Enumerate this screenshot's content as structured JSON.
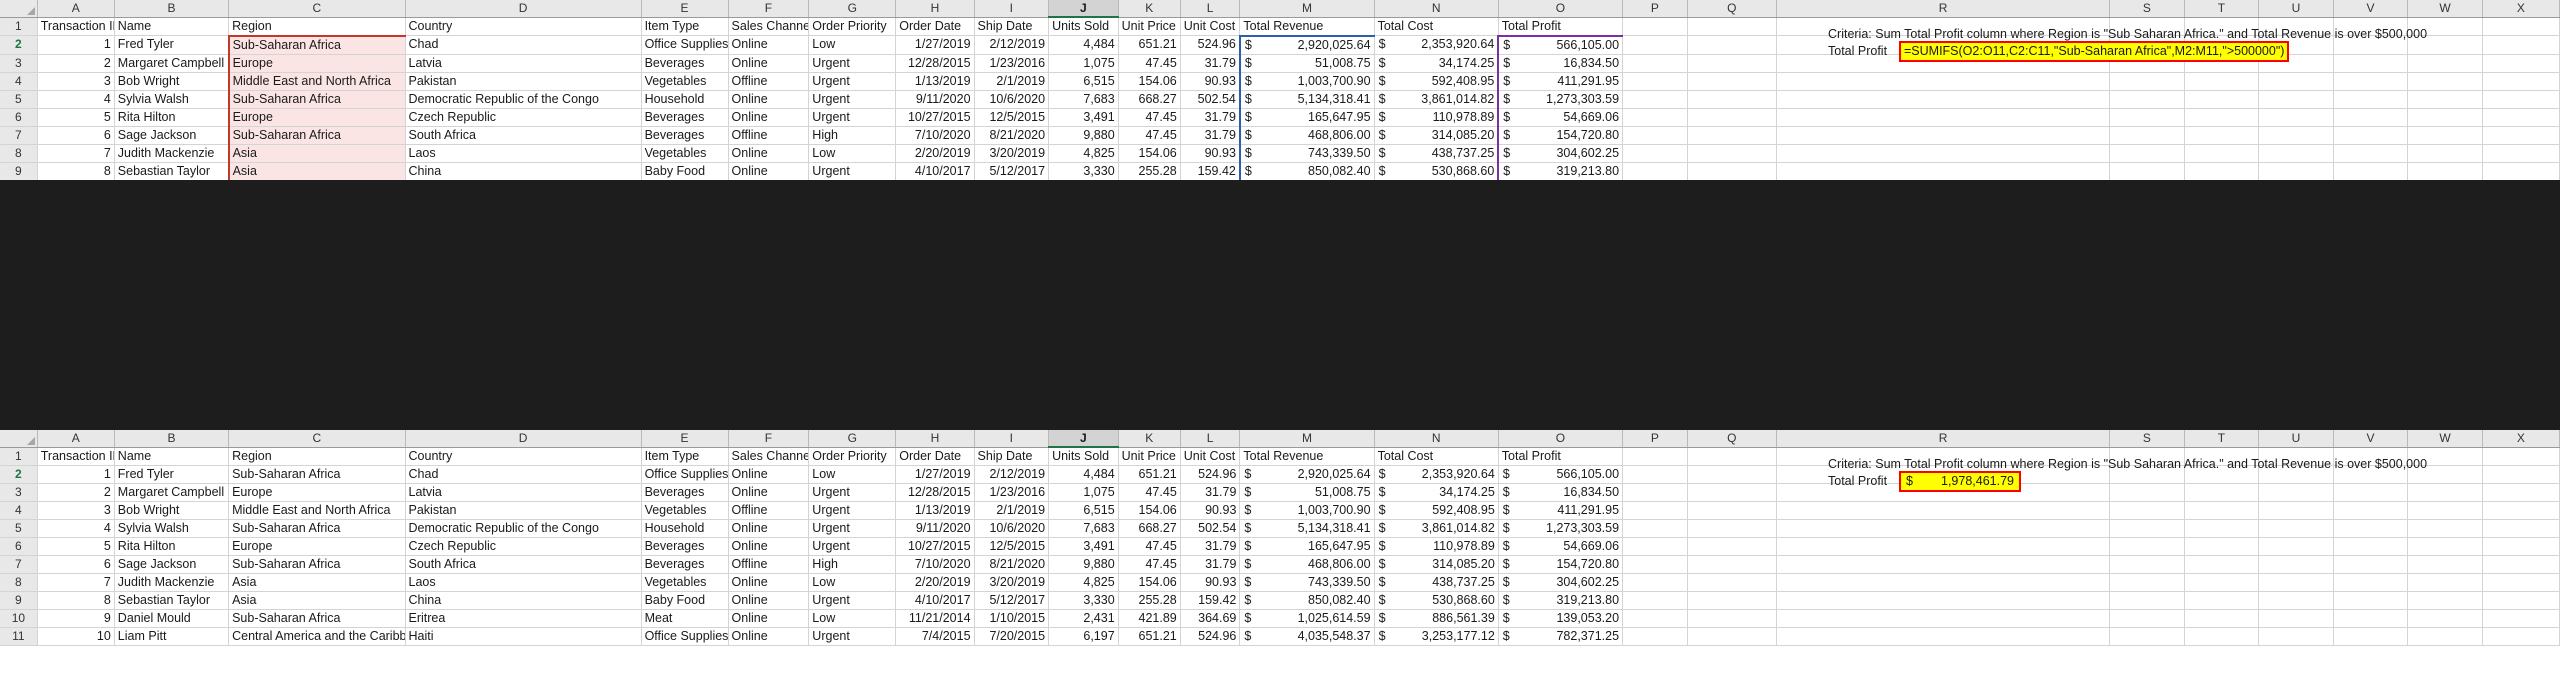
{
  "app": "excel-spreadsheet",
  "columns": [
    "A",
    "B",
    "C",
    "D",
    "E",
    "F",
    "G",
    "H",
    "I",
    "J",
    "K",
    "L",
    "M",
    "N",
    "O",
    "P",
    "Q",
    "R",
    "S",
    "T",
    "U",
    "V",
    "W",
    "X"
  ],
  "row_numbers": [
    "1",
    "2",
    "3",
    "4",
    "5",
    "6",
    "7",
    "8",
    "9",
    "10",
    "11"
  ],
  "selected_column": "J",
  "headers": {
    "a": "Transaction ID",
    "b": "Name",
    "c": "Region",
    "d": "Country",
    "e": "Item Type",
    "f": "Sales Channel",
    "g": "Order Priority",
    "h": "Order Date",
    "i": "Ship Date",
    "j": "Units Sold",
    "k": "Unit Price",
    "l": "Unit Cost",
    "m": "Total Revenue",
    "n": "Total Cost",
    "o": "Total Profit"
  },
  "rows": [
    {
      "id": "1",
      "name": "Fred Tyler",
      "region": "Sub-Saharan Africa",
      "country": "Chad",
      "item": "Office Supplies",
      "channel": "Online",
      "priority": "Low",
      "order_date": "1/27/2019",
      "ship_date": "2/12/2019",
      "units": "4,484",
      "unit_price": "651.21",
      "unit_cost": "524.96",
      "revenue": "2,920,025.64",
      "cost": "2,353,920.64",
      "profit": "566,105.00"
    },
    {
      "id": "2",
      "name": "Margaret Campbell",
      "region": "Europe",
      "country": "Latvia",
      "item": "Beverages",
      "channel": "Online",
      "priority": "Urgent",
      "order_date": "12/28/2015",
      "ship_date": "1/23/2016",
      "units": "1,075",
      "unit_price": "47.45",
      "unit_cost": "31.79",
      "revenue": "51,008.75",
      "cost": "34,174.25",
      "profit": "16,834.50"
    },
    {
      "id": "3",
      "name": "Bob Wright",
      "region": "Middle East and North Africa",
      "country": "Pakistan",
      "item": "Vegetables",
      "channel": "Offline",
      "priority": "Urgent",
      "order_date": "1/13/2019",
      "ship_date": "2/1/2019",
      "units": "6,515",
      "unit_price": "154.06",
      "unit_cost": "90.93",
      "revenue": "1,003,700.90",
      "cost": "592,408.95",
      "profit": "411,291.95"
    },
    {
      "id": "4",
      "name": "Sylvia Walsh",
      "region": "Sub-Saharan Africa",
      "country": "Democratic Republic of the Congo",
      "item": "Household",
      "channel": "Online",
      "priority": "Urgent",
      "order_date": "9/11/2020",
      "ship_date": "10/6/2020",
      "units": "7,683",
      "unit_price": "668.27",
      "unit_cost": "502.54",
      "revenue": "5,134,318.41",
      "cost": "3,861,014.82",
      "profit": "1,273,303.59"
    },
    {
      "id": "5",
      "name": "Rita Hilton",
      "region": "Europe",
      "country": "Czech Republic",
      "item": "Beverages",
      "channel": "Online",
      "priority": "Urgent",
      "order_date": "10/27/2015",
      "ship_date": "12/5/2015",
      "units": "3,491",
      "unit_price": "47.45",
      "unit_cost": "31.79",
      "revenue": "165,647.95",
      "cost": "110,978.89",
      "profit": "54,669.06"
    },
    {
      "id": "6",
      "name": "Sage Jackson",
      "region": "Sub-Saharan Africa",
      "country": "South Africa",
      "item": "Beverages",
      "channel": "Offline",
      "priority": "High",
      "order_date": "7/10/2020",
      "ship_date": "8/21/2020",
      "units": "9,880",
      "unit_price": "47.45",
      "unit_cost": "31.79",
      "revenue": "468,806.00",
      "cost": "314,085.20",
      "profit": "154,720.80"
    },
    {
      "id": "7",
      "name": "Judith Mackenzie",
      "region": "Asia",
      "country": "Laos",
      "item": "Vegetables",
      "channel": "Online",
      "priority": "Low",
      "order_date": "2/20/2019",
      "ship_date": "3/20/2019",
      "units": "4,825",
      "unit_price": "154.06",
      "unit_cost": "90.93",
      "revenue": "743,339.50",
      "cost": "438,737.25",
      "profit": "304,602.25"
    },
    {
      "id": "8",
      "name": "Sebastian Taylor",
      "region": "Asia",
      "country": "China",
      "item": "Baby Food",
      "channel": "Online",
      "priority": "Urgent",
      "order_date": "4/10/2017",
      "ship_date": "5/12/2017",
      "units": "3,330",
      "unit_price": "255.28",
      "unit_cost": "159.42",
      "revenue": "850,082.40",
      "cost": "530,868.60",
      "profit": "319,213.80"
    },
    {
      "id": "9",
      "name": "Daniel Mould",
      "region": "Sub-Saharan Africa",
      "country": "Eritrea",
      "item": "Meat",
      "channel": "Online",
      "priority": "Low",
      "order_date": "11/21/2014",
      "ship_date": "1/10/2015",
      "units": "2,431",
      "unit_price": "421.89",
      "unit_cost": "364.69",
      "revenue": "1,025,614.59",
      "cost": "886,561.39",
      "profit": "139,053.20"
    },
    {
      "id": "10",
      "name": "Liam Pitt",
      "region": "Central America and the Caribbean",
      "country": "Haiti",
      "item": "Office Supplies",
      "channel": "Online",
      "priority": "Urgent",
      "order_date": "7/4/2015",
      "ship_date": "7/20/2015",
      "units": "6,197",
      "unit_price": "651.21",
      "unit_cost": "524.96",
      "revenue": "4,035,548.37",
      "cost": "3,253,177.12",
      "profit": "782,371.25"
    }
  ],
  "sidebar_panel": {
    "criteria_label": "Criteria: Sum Total Profit column where Region is \"Sub Saharan Africa.\" and Total Revenue is over $500,000",
    "total_profit_label": "Total Profit",
    "formula": "=SUMIFS(O2:O11,C2:C11,\"Sub-Saharan Africa\",M2:M11,\">500000\")",
    "result_currency": "$",
    "result_value": "1,978,461.79"
  },
  "colors": {
    "sum_range_border": "#7b2fa0",
    "criteria_range_border": "#c0392b",
    "criteria2_range_border": "#2c5fa8",
    "highlight_fill": "#ffff00",
    "highlight_border": "#ff0000",
    "selected_tab": "#217346"
  }
}
